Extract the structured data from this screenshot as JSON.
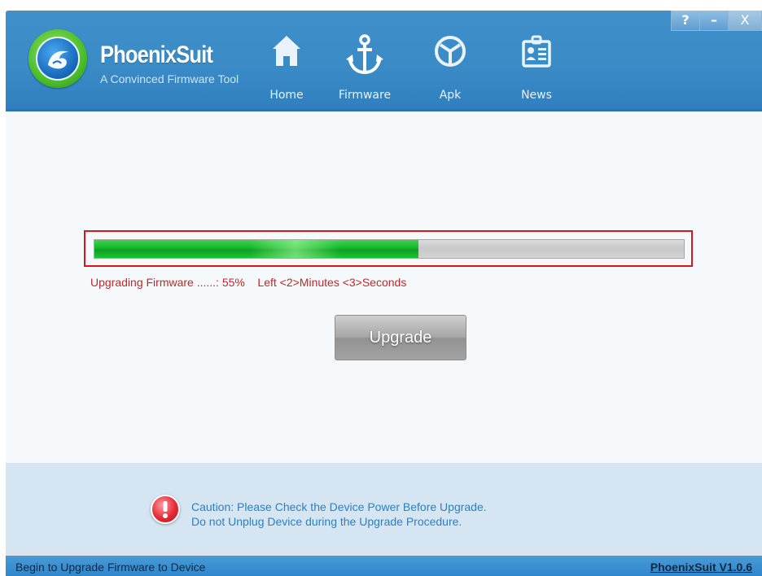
{
  "app": {
    "title": "PhoenixSuit",
    "subtitle": "A Convinced Firmware Tool"
  },
  "nav": {
    "items": [
      {
        "label": "Home",
        "icon": "house-icon"
      },
      {
        "label": "Firmware",
        "icon": "anchor-icon"
      },
      {
        "label": "Apk",
        "icon": "apk-icon"
      },
      {
        "label": "News",
        "icon": "news-icon"
      }
    ],
    "active": "Firmware"
  },
  "window_controls": {
    "help": "?",
    "minimize": "–",
    "close": "X"
  },
  "progress": {
    "percent": 55,
    "status_text": "Upgrading Firmware ......: 55%",
    "remaining_text": "Left <2>Minutes <3>Seconds"
  },
  "upgrade_button": {
    "label": "Upgrade",
    "enabled": false
  },
  "caution": {
    "line1": "Caution: Please Check the Device Power Before Upgrade.",
    "line2": "Do not Unplug Device during the Upgrade Procedure."
  },
  "status_bar": {
    "message": "Begin to Upgrade Firmware to Device",
    "version": "PhoenixSuit V1.0.6"
  },
  "colors": {
    "header": "#3a8bc6",
    "progress_green": "#14b82a",
    "highlight_red": "#d7171c",
    "status_text_red": "#c0272d",
    "caution_blue": "#2d7fc4"
  }
}
